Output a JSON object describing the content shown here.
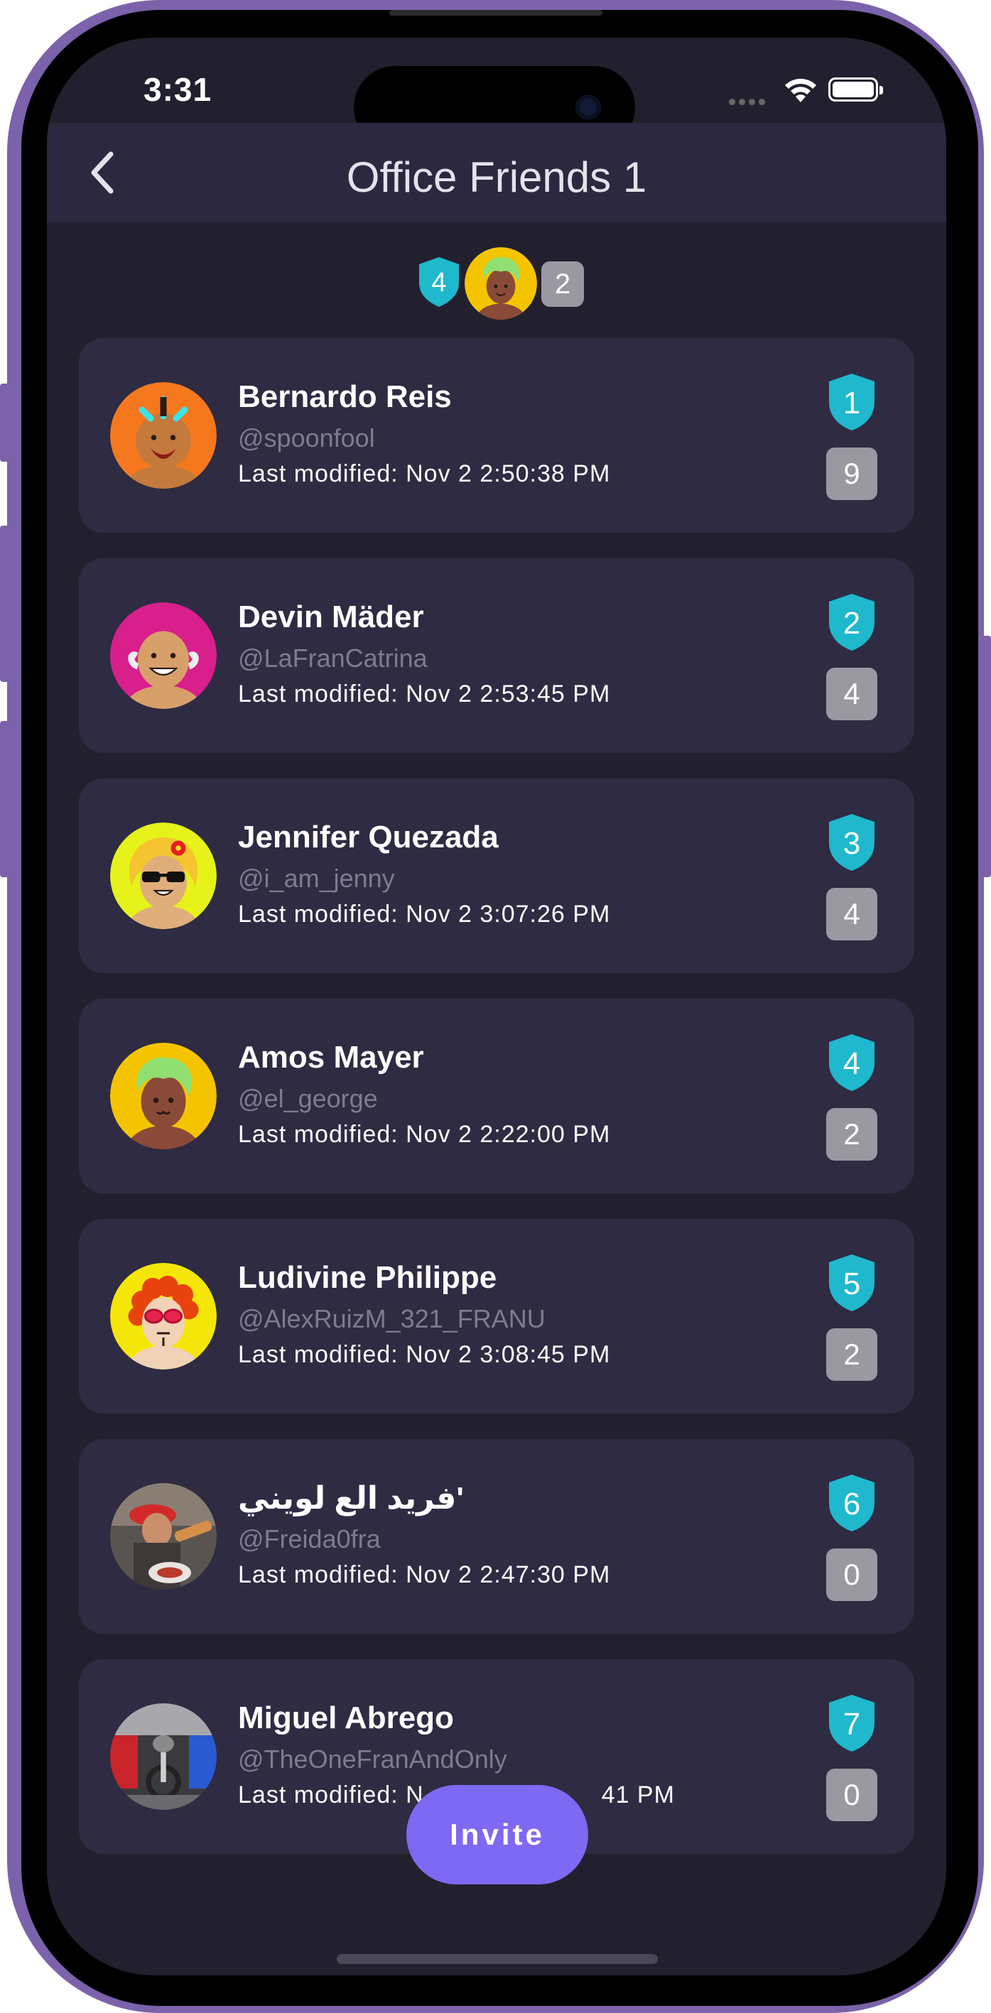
{
  "status_bar": {
    "time": "3:31"
  },
  "nav": {
    "title": "Office Friends 1"
  },
  "summary": {
    "rank": "4",
    "count": "2"
  },
  "friends": [
    {
      "name": "Bernardo Reis",
      "handle": "@spoonfool",
      "modified": "Last modified: Nov 2 2:50:38 PM",
      "rank": "1",
      "count": "9",
      "avatar": "orange-guy-avatar"
    },
    {
      "name": "Devin Mäder",
      "handle": "@LaFranCatrina",
      "modified": "Last modified: Nov 2 2:53:45 PM",
      "rank": "2",
      "count": "4",
      "avatar": "bald-smiling-avatar"
    },
    {
      "name": "Jennifer Quezada",
      "handle": "@i_am_jenny",
      "modified": "Last modified: Nov 2 3:07:26 PM",
      "rank": "3",
      "count": "4",
      "avatar": "sunglasses-flower-avatar"
    },
    {
      "name": "Amos Mayer",
      "handle": "@el_george",
      "modified": "Last modified: Nov 2 2:22:00 PM",
      "rank": "4",
      "count": "2",
      "avatar": "green-hair-avatar"
    },
    {
      "name": "Ludivine Philippe",
      "handle": "@AlexRuizM_321_FRANU",
      "modified": "Last modified: Nov 2 3:08:45 PM",
      "rank": "5",
      "count": "2",
      "avatar": "curly-red-hair-avatar"
    },
    {
      "name": "فريد الع لويني'",
      "handle": "@Freida0fra",
      "modified": "Last modified: Nov 2 2:47:30 PM",
      "rank": "6",
      "count": "0",
      "avatar": "photo-avatar-red-cap"
    },
    {
      "name": "Miguel Abrego",
      "handle": "@TheOneFranAndOnly",
      "modified": "Last modified: N",
      "modified_tail": "41 PM",
      "rank": "7",
      "count": "0",
      "avatar": "photo-avatar-bike"
    }
  ],
  "invite": {
    "label": "Invite"
  },
  "colors": {
    "accent": "#7d69f2",
    "shield": "#1fb8cd",
    "card": "#2e2b42",
    "background": "#22202e",
    "frame": "#7b62aa"
  }
}
